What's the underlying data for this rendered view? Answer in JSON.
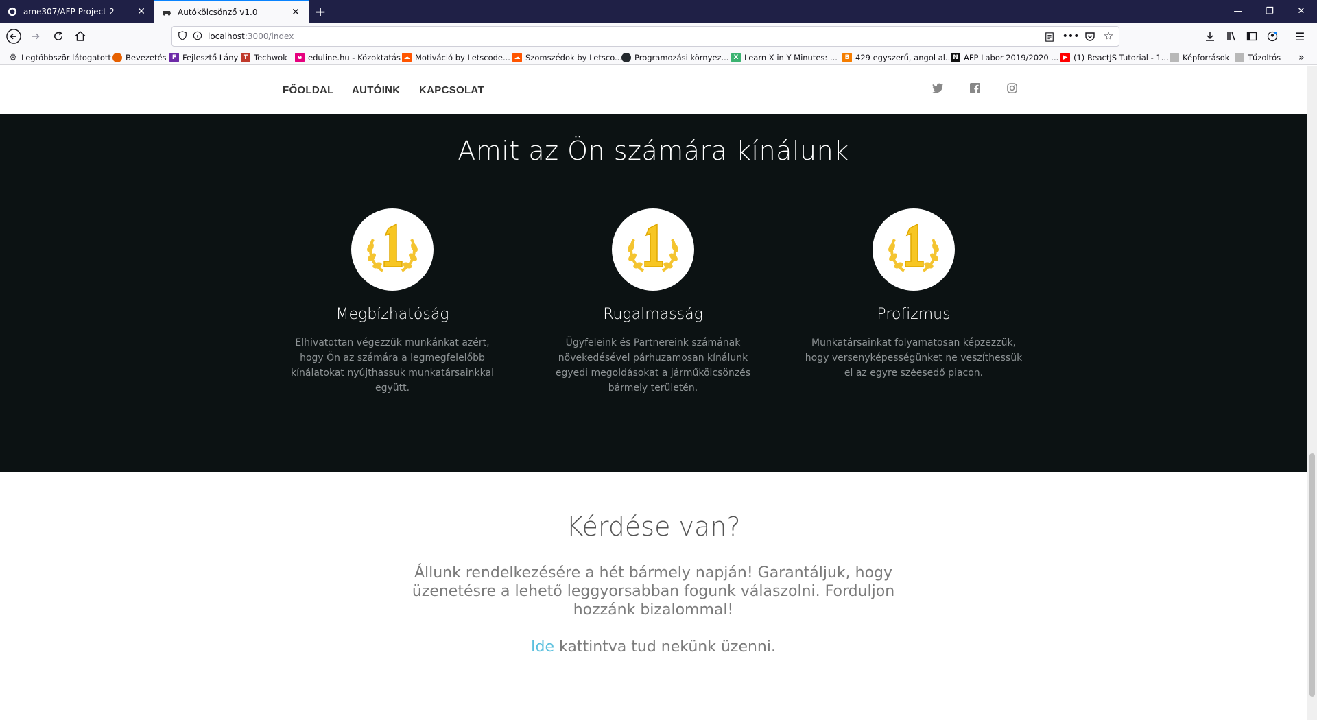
{
  "browser": {
    "tabs": [
      {
        "label": "ame307/AFP-Project-2",
        "active": false,
        "icon": "github-icon"
      },
      {
        "label": "Autókölcsönző v1.0",
        "active": true,
        "icon": "car-icon"
      }
    ],
    "url": {
      "host": "localhost",
      "path": ":3000/index"
    },
    "bookmarks": [
      {
        "label": "Legtöbbször látogatott",
        "icon": "gear-icon",
        "color": "#4a4a4f"
      },
      {
        "label": "Bevezetés",
        "icon": "firefox-icon",
        "color": "#e66000"
      },
      {
        "label": "Fejlesztő Lány",
        "icon": "site-icon",
        "color": "#6d2aa7"
      },
      {
        "label": "Techwok",
        "icon": "site-icon",
        "color": "#c0392b"
      },
      {
        "label": "eduline.hu - Közoktatás",
        "icon": "site-icon",
        "color": "#e6007e"
      },
      {
        "label": "Motiváció by Letscode...",
        "icon": "soundcloud-icon",
        "color": "#ff5500"
      },
      {
        "label": "Szomszédok by Letsco...",
        "icon": "soundcloud-icon",
        "color": "#ff5500"
      },
      {
        "label": "Programozási környez...",
        "icon": "github-icon",
        "color": "#24292e"
      },
      {
        "label": "Learn X in Y Minutes: ...",
        "icon": "site-icon",
        "color": "#3cb371"
      },
      {
        "label": "429 egyszerű, angol al...",
        "icon": "blogger-icon",
        "color": "#f57d00"
      },
      {
        "label": "AFP Labor 2019/2020 ...",
        "icon": "notion-icon",
        "color": "#111111"
      },
      {
        "label": "(1) ReactJS Tutorial - 1...",
        "icon": "youtube-icon",
        "color": "#ff0000"
      },
      {
        "label": "Képforrások",
        "icon": "folder-icon",
        "color": "#8a8a8a"
      },
      {
        "label": "Tűzoltós",
        "icon": "folder-icon",
        "color": "#8a8a8a"
      }
    ]
  },
  "site": {
    "nav": [
      "FŐOLDAL",
      "AUTÓINK",
      "KAPCSOLAT"
    ],
    "social": [
      "twitter-icon",
      "facebook-icon",
      "instagram-icon"
    ],
    "offer": {
      "title": "Amit az Ön számára kínálunk",
      "features": [
        {
          "title": "Megbízhatóság",
          "text": "Elhivatottan végezzük munkánkat azért, hogy Ön az számára a legmegfelelőbb kínálatokat nyújthassuk munkatársainkkal együtt."
        },
        {
          "title": "Rugalmasság",
          "text": "Ügyfeleink és Partnereink számának növekedésével párhuzamosan kínálunk egyedi megoldásokat a járműkölcsönzés bármely területén."
        },
        {
          "title": "Profizmus",
          "text": "Munkatársainkat folyamatosan képzezzük, hogy versenyképességünket ne veszíthessük el az egyre széesedő piacon."
        }
      ]
    },
    "question": {
      "title": "Kérdése van?",
      "text": "Állunk rendelkezésére a hét bármely napján! Garantáljuk, hogy üzenetésre a lehető leggyorsabban fogunk válaszolni. Forduljon hozzánk bizalommal!",
      "link": "Ide",
      "cta_rest": " kattintva tud nekünk üzenni."
    }
  },
  "colors": {
    "dark_bg": "#0c1213",
    "link": "#5bc0de",
    "medal": "#f4c430"
  }
}
